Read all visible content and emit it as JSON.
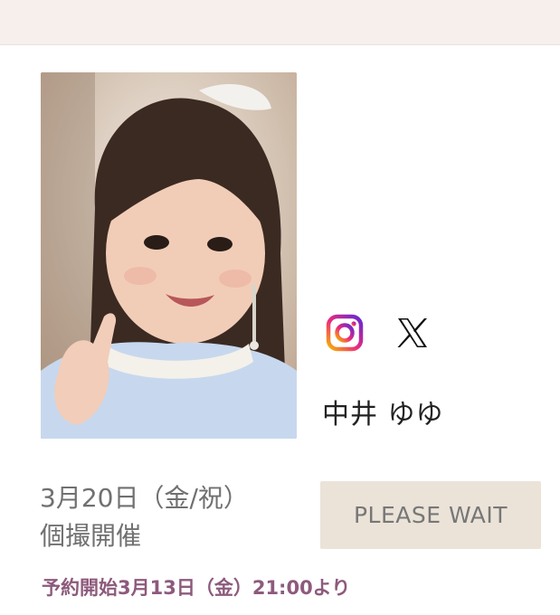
{
  "header": {},
  "card": {
    "photo_icon": "portrait-photo",
    "social": {
      "instagram_icon": "instagram-icon",
      "x_icon": "x-logo-icon"
    },
    "name": "中井 ゆゆ",
    "date_line1": "3月20日（金/祝）",
    "date_line2": "個撮開催",
    "button_label": "PLEASE WAIT",
    "reservation_text": "予約開始3月13日（金）21:00より"
  },
  "colors": {
    "top_band": "#f6efec",
    "button_bg": "#ebe3d8",
    "button_text": "#777777",
    "reservation_text": "#8d5a7c",
    "date_text": "#707070",
    "name_text": "#222222"
  }
}
